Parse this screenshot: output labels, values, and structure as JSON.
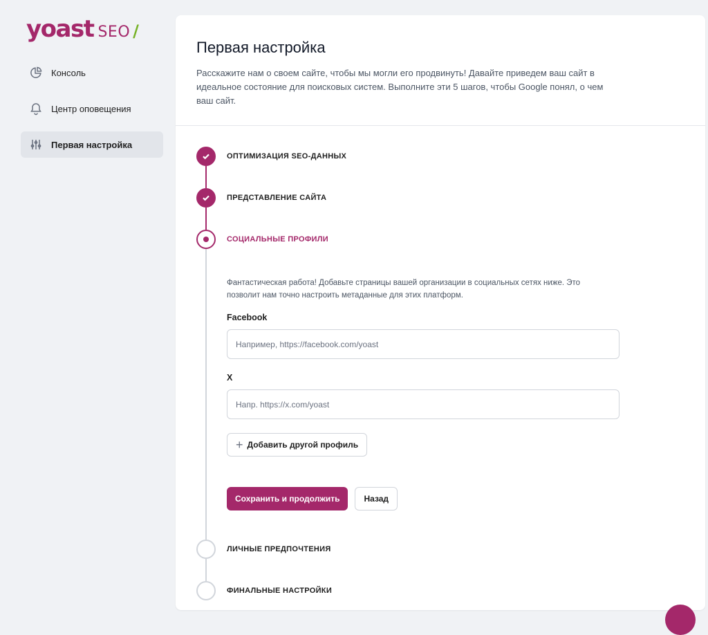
{
  "brand": {
    "logo_main": "yoast",
    "logo_seo": "SEO",
    "logo_slash": "/"
  },
  "sidebar": {
    "items": [
      {
        "label": "Консоль",
        "icon": "pie-chart-icon"
      },
      {
        "label": "Центр оповещения",
        "icon": "bell-icon"
      },
      {
        "label": "Первая настройка",
        "icon": "sliders-icon",
        "active": true
      }
    ]
  },
  "header": {
    "title": "Первая настройка",
    "description": "Расскажите нам о своем сайте, чтобы мы могли его продвинуть! Давайте приведем ваш сайт в идеальное состояние для поисковых систем. Выполните эти 5 шагов, чтобы Google понял, о чем ваш сайт."
  },
  "steps": [
    {
      "label": "Оптимизация SEO-данных",
      "status": "done"
    },
    {
      "label": "Представление сайта",
      "status": "done"
    },
    {
      "label": "Социальные профили",
      "status": "current"
    },
    {
      "label": "Личные предпочтения",
      "status": "pending"
    },
    {
      "label": "Финальные настройки",
      "status": "pending"
    }
  ],
  "social": {
    "intro": "Фантастическая работа! Добавьте страницы вашей организации в социальных сетях ниже. Это позволит нам точно настроить метаданные для этих платформ.",
    "facebook_label": "Facebook",
    "facebook_placeholder": "Например, https://facebook.com/yoast",
    "facebook_value": "",
    "x_label": "X",
    "x_placeholder": "Напр. https://x.com/yoast",
    "x_value": "",
    "add_profile_label": "Добавить другой профиль",
    "save_label": "Сохранить и продолжить",
    "back_label": "Назад"
  },
  "colors": {
    "accent": "#a4286a",
    "slash": "#77b227",
    "line_pending": "#d1d5db"
  }
}
